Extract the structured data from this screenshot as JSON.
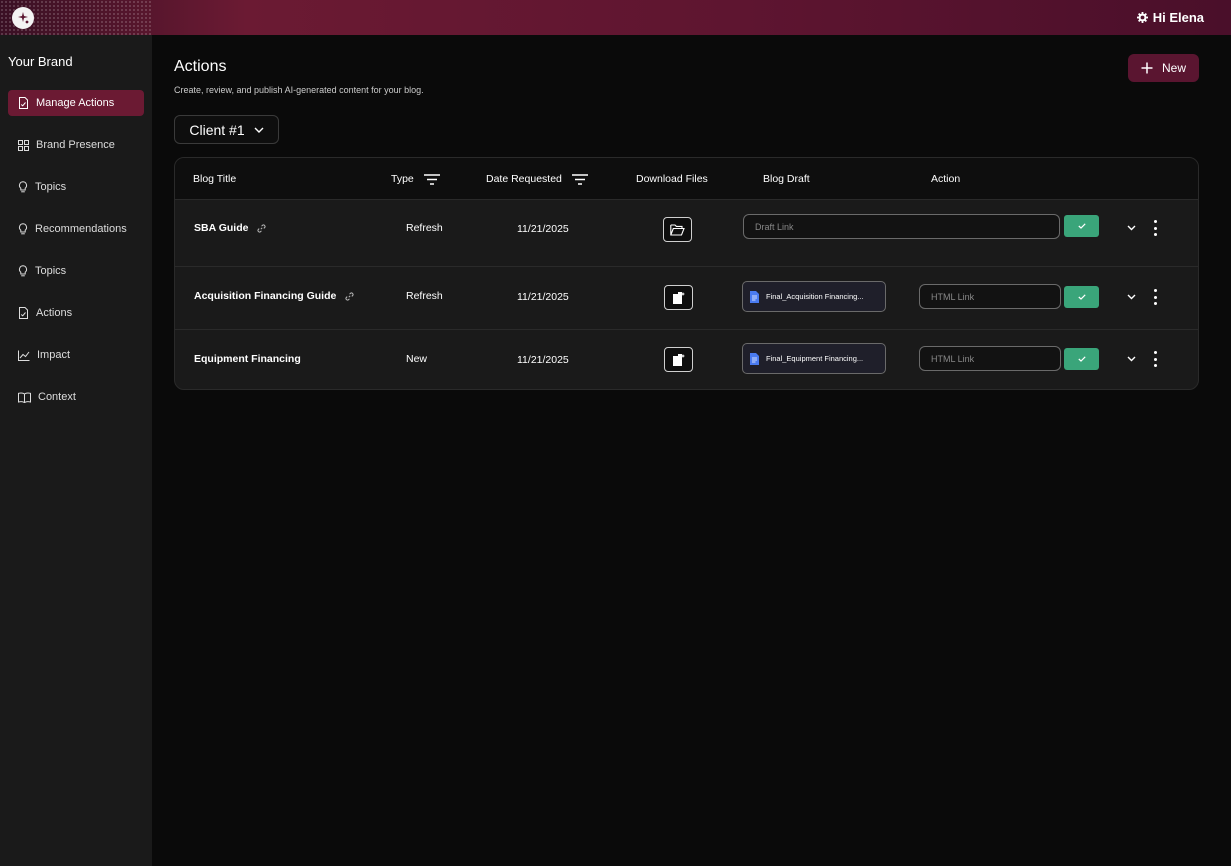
{
  "header": {
    "user_greeting": "Hi Elena"
  },
  "sidebar": {
    "brand": "Your Brand",
    "items": [
      {
        "label": "Manage Actions",
        "icon": "document-icon"
      },
      {
        "label": "Brand Presence",
        "icon": "grid-icon"
      },
      {
        "label": "Topics",
        "icon": "lightbulb-icon"
      },
      {
        "label": "Recommendations",
        "icon": "lightbulb-icon"
      },
      {
        "label": "Topics",
        "icon": "lightbulb-icon"
      },
      {
        "label": "Actions",
        "icon": "document-icon"
      },
      {
        "label": "Impact",
        "icon": "chart-icon"
      },
      {
        "label": "Context",
        "icon": "book-icon"
      }
    ]
  },
  "page": {
    "title": "Actions",
    "subtitle": "Create, review, and publish AI-generated content for your blog.",
    "new_label": "New",
    "client_select": "Client #1"
  },
  "table": {
    "columns": [
      "Blog Title",
      "Type",
      "Date Requested",
      "Download Files",
      "Blog Draft",
      "Action"
    ],
    "rows": [
      {
        "title": "SBA Guide",
        "type": "Refresh",
        "date": "11/21/2025",
        "draft_placeholder": "Draft Link"
      },
      {
        "title": "Acquisition Financing Guide",
        "type": "Refresh",
        "date": "11/21/2025",
        "draft_file": "Final_Acquisition Financing...",
        "html_placeholder": "HTML Link"
      },
      {
        "title": "Equipment Financing",
        "type": "New",
        "date": "11/21/2025",
        "draft_file": "Final_Equipment Financing...",
        "html_placeholder": "HTML Link"
      }
    ]
  },
  "colors": {
    "accent": "#6b1a33",
    "success": "#3aa57a"
  }
}
